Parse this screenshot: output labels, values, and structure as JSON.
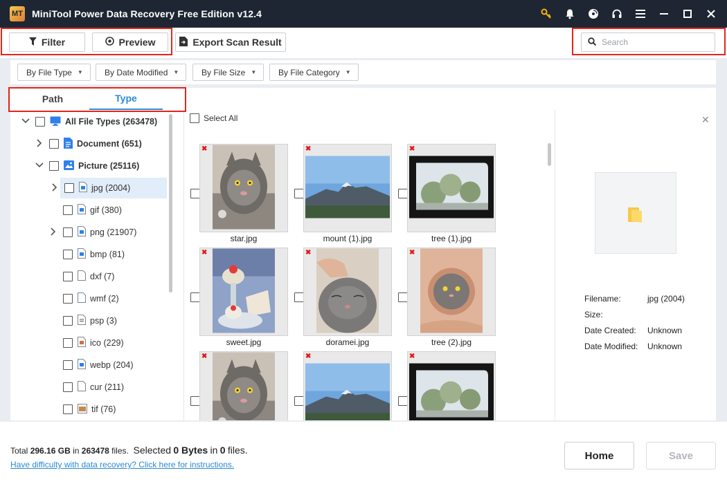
{
  "app": {
    "title": "MiniTool Power Data Recovery Free Edition v12.4",
    "logo": "MT"
  },
  "titlebar_icons": [
    "key-icon",
    "bell-icon",
    "disc-icon",
    "headphones-icon",
    "menu-icon",
    "minimize-icon",
    "maximize-icon",
    "close-icon"
  ],
  "toolbar": {
    "filter_label": "Filter",
    "preview_label": "Preview",
    "export_label": "Export Scan Result",
    "search_placeholder": "Search"
  },
  "filters": [
    "By File Type",
    "By Date Modified",
    "By File Size",
    "By File Category"
  ],
  "tabs": {
    "path": "Path",
    "type": "Type",
    "active": "Type"
  },
  "tree": [
    {
      "label": "All File Types (263478)",
      "bold": true,
      "chevron": "down",
      "icon": "monitor-icon"
    },
    {
      "label": "Document (651)",
      "bold": true,
      "chevron": "right",
      "icon": "document-icon"
    },
    {
      "label": "Picture (25116)",
      "bold": true,
      "chevron": "down",
      "icon": "picture-icon"
    },
    {
      "label": "jpg (2004)",
      "chevron": "right",
      "icon": "image-file-icon",
      "selected": true
    },
    {
      "label": "gif (380)",
      "icon": "image-file-icon"
    },
    {
      "label": "png (21907)",
      "chevron": "right",
      "icon": "image-file-icon"
    },
    {
      "label": "bmp (81)",
      "icon": "image-file-icon"
    },
    {
      "label": "dxf (7)",
      "icon": "blank-file-icon"
    },
    {
      "label": "wmf (2)",
      "icon": "blank-file-icon"
    },
    {
      "label": "psp (3)",
      "icon": "psp-file-icon"
    },
    {
      "label": "ico (229)",
      "icon": "ico-file-icon"
    },
    {
      "label": "webp (204)",
      "icon": "image-file-icon"
    },
    {
      "label": "cur (211)",
      "icon": "blank-file-icon"
    },
    {
      "label": "tif (76)",
      "icon": "tif-file-icon"
    }
  ],
  "grid": {
    "select_all_label": "Select All",
    "items": [
      {
        "name": "star.jpg",
        "kind": "cat-portrait"
      },
      {
        "name": "mount (1).jpg",
        "kind": "mountain"
      },
      {
        "name": "tree (1).jpg",
        "kind": "car-window"
      },
      {
        "name": "sweet.jpg",
        "kind": "dessert"
      },
      {
        "name": "doramei.jpg",
        "kind": "cat-hand"
      },
      {
        "name": "tree (2).jpg",
        "kind": "cat-hole"
      },
      {
        "name": "",
        "kind": "cat-portrait"
      },
      {
        "name": "",
        "kind": "mountain"
      },
      {
        "name": "",
        "kind": "car-window"
      }
    ]
  },
  "preview": {
    "close_icon": "close-icon",
    "rows": [
      {
        "label": "Filename:",
        "value": "jpg (2004)"
      },
      {
        "label": "Size:",
        "value": ""
      },
      {
        "label": "Date Created:",
        "value": "Unknown"
      },
      {
        "label": "Date Modified:",
        "value": "Unknown"
      }
    ]
  },
  "footer": {
    "total_label": "Total",
    "total_size": "296.16 GB",
    "in_label": "in",
    "total_files": "263478",
    "files_label": "files.",
    "selected_label": "Selected",
    "selected_size": "0 Bytes",
    "in_label2": "in",
    "selected_files": "0",
    "files_label2": "files.",
    "help_link": "Have difficulty with data recovery? Click here for instructions.",
    "home_label": "Home",
    "save_label": "Save"
  },
  "colors": {
    "titlebar": "#1e2633",
    "accent": "#2a8ad6",
    "highlight": "#e8231a",
    "selected_row": "#e1edf9"
  }
}
